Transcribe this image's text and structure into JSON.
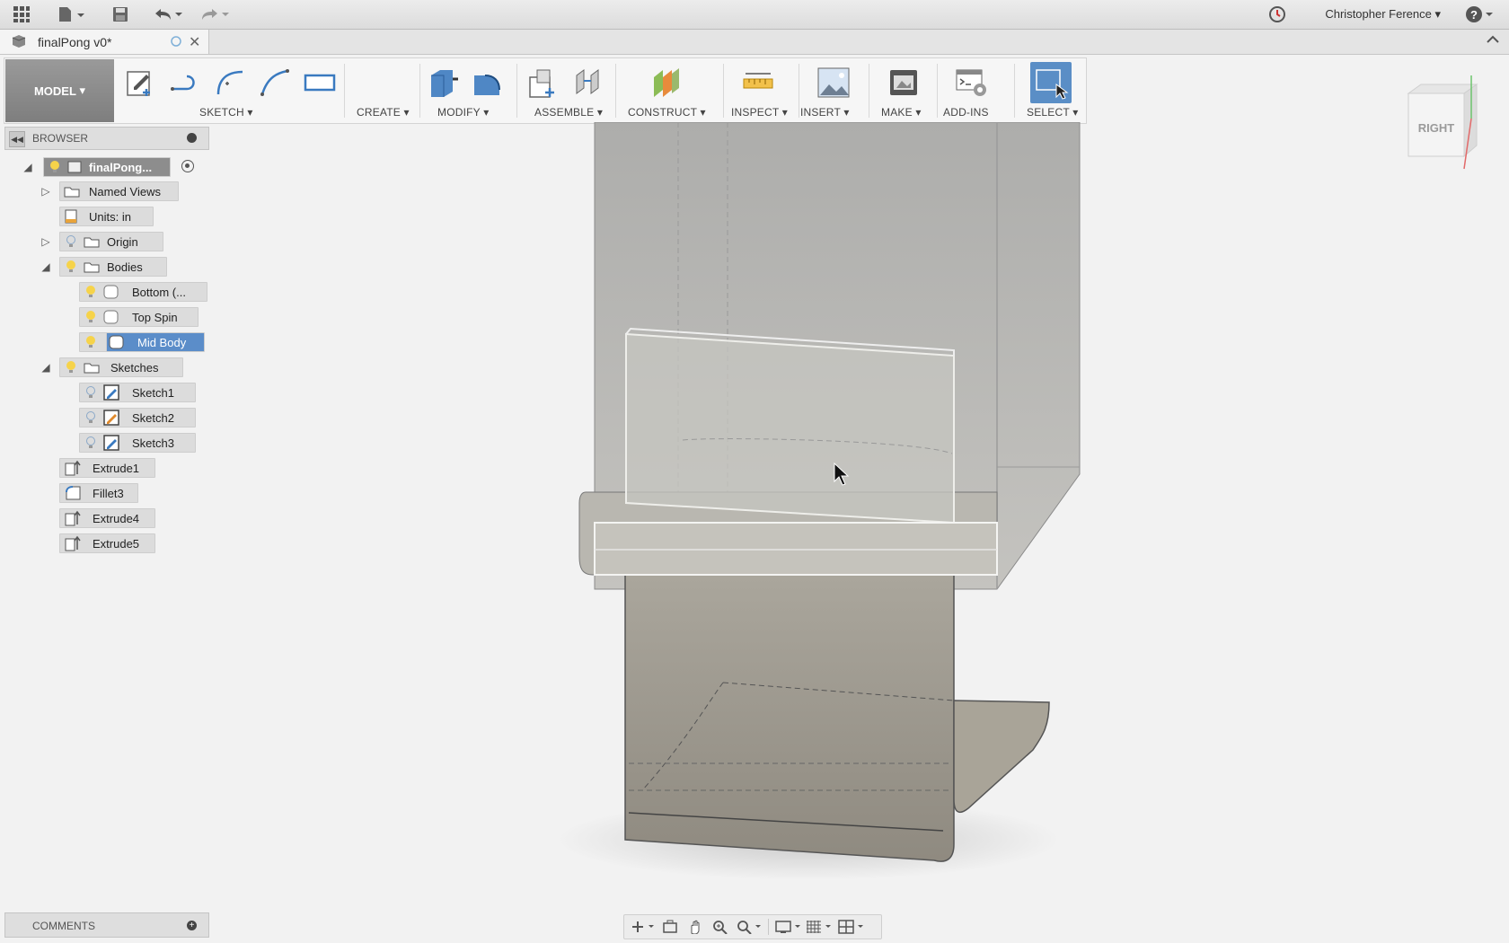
{
  "app": {
    "user_name": "Christopher Ference",
    "document_title": "finalPong v0*"
  },
  "toolbar": {
    "workspace": "MODEL",
    "groups": [
      {
        "label": "SKETCH"
      },
      {
        "label": "CREATE"
      },
      {
        "label": "MODIFY"
      },
      {
        "label": "ASSEMBLE"
      },
      {
        "label": "CONSTRUCT"
      },
      {
        "label": "INSPECT"
      },
      {
        "label": "INSERT"
      },
      {
        "label": "MAKE"
      },
      {
        "label": "ADD-INS"
      },
      {
        "label": "SELECT"
      }
    ],
    "accent": "#5a8ec6"
  },
  "browser": {
    "header": "BROWSER",
    "root": "finalPong...",
    "named_views": "Named Views",
    "units": "Units: in",
    "origin": "Origin",
    "bodies": "Bodies",
    "body_items": [
      "Bottom (...",
      "Top Spin",
      "Mid Body"
    ],
    "selected_body": "Mid Body",
    "sketches": "Sketches",
    "sketch_items": [
      "Sketch1",
      "Sketch2",
      "Sketch3"
    ],
    "features": [
      "Extrude1",
      "Fillet3",
      "Extrude4",
      "Extrude5"
    ]
  },
  "viewcube": {
    "face": "RIGHT"
  },
  "comments": {
    "label": "COMMENTS"
  }
}
